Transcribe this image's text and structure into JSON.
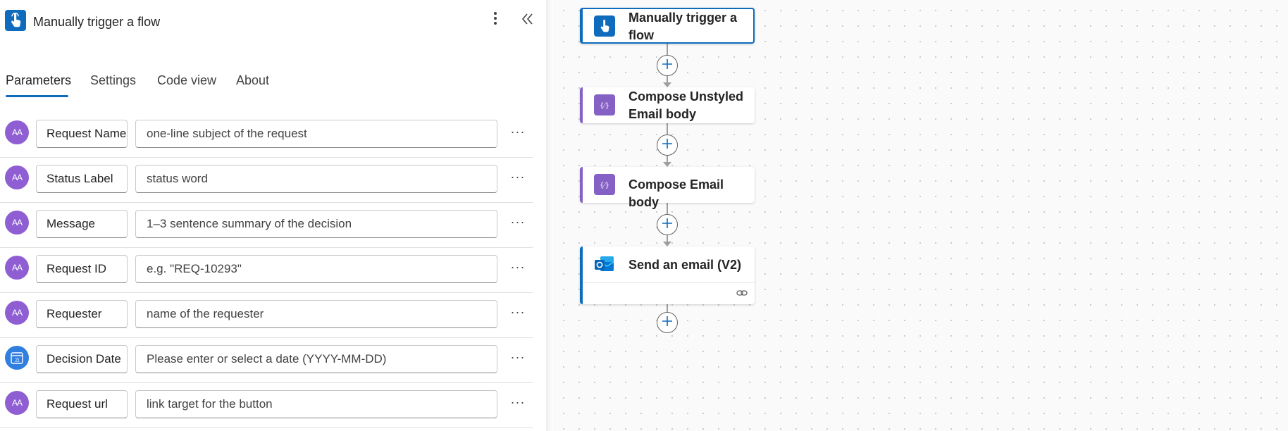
{
  "header": {
    "title": "Manually trigger a flow",
    "trigger_icon": "touch-icon",
    "more_icon": "vertical-ellipsis-icon",
    "collapse_icon": "double-chevron-left-icon"
  },
  "tabs": [
    {
      "label": "Parameters",
      "active": true
    },
    {
      "label": "Settings",
      "active": false
    },
    {
      "label": "Code view",
      "active": false
    },
    {
      "label": "About",
      "active": false
    }
  ],
  "parameters": [
    {
      "type": "text",
      "avatar": "AA",
      "name": "Request Name",
      "value": "one-line subject of the request"
    },
    {
      "type": "text",
      "avatar": "AA",
      "name": "Status Label",
      "value": "status word"
    },
    {
      "type": "text",
      "avatar": "AA",
      "name": "Message",
      "value": "1–3 sentence summary of the decision"
    },
    {
      "type": "text",
      "avatar": "AA",
      "name": "Request ID",
      "value": "e.g. \"REQ-10293\""
    },
    {
      "type": "text",
      "avatar": "AA",
      "name": "Requester",
      "value": "name of the requester"
    },
    {
      "type": "date",
      "avatar": "21",
      "name": "Decision Date",
      "value": "Please enter or select a date (YYYY-MM-DD)"
    },
    {
      "type": "text",
      "avatar": "AA",
      "name": "Request url",
      "value": "link target for the button"
    }
  ],
  "param_more": "···",
  "flow": {
    "nodes": [
      {
        "title": "Manually trigger a flow",
        "icon": "touch-icon",
        "selected": true,
        "accent": "#0f6cbd"
      },
      {
        "title": "Compose Unstyled Email body",
        "icon": "compose-icon",
        "selected": false,
        "accent": "#8661c5"
      },
      {
        "title": "Compose Email body",
        "icon": "compose-icon",
        "selected": false,
        "accent": "#8661c5"
      },
      {
        "title": "Send an email (V2)",
        "icon": "outlook-icon",
        "selected": false,
        "accent": "#0f6cbd",
        "footer_icon": "link-icon"
      }
    ],
    "add_icon": "plus-icon"
  },
  "colors": {
    "accent": "#0f6cbd",
    "compose": "#8661c5",
    "text_param": "#8f5ed3",
    "date_param": "#2f7ee0"
  }
}
